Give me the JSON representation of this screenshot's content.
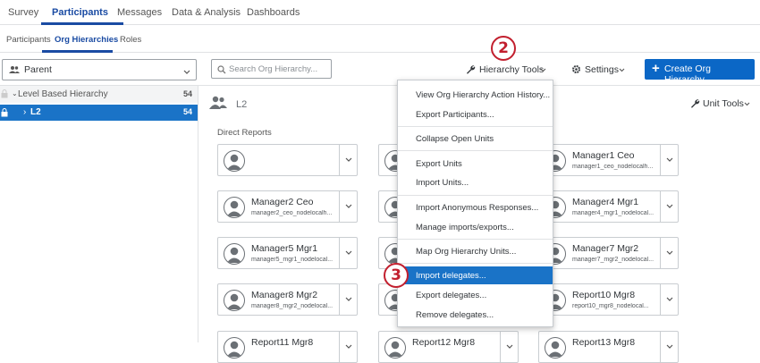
{
  "top_tabs": [
    "Survey",
    "Participants",
    "Messages",
    "Data & Analysis",
    "Dashboards"
  ],
  "sub_tabs": [
    "Participants",
    "Org Hierarchies",
    "Roles"
  ],
  "toolbar": {
    "parent_label": "Parent",
    "search_placeholder": "Search Org Hierarchy...",
    "hierarchy_tools": "Hierarchy Tools",
    "settings": "Settings",
    "create": "Create Org Hierarchy..."
  },
  "tree": [
    {
      "label": "Level Based Hierarchy",
      "count": "54"
    },
    {
      "label": "L2",
      "count": "54"
    }
  ],
  "main": {
    "unit_label": "L2",
    "unit_tools": "Unit Tools",
    "direct_reports": "Direct Reports"
  },
  "cards": [
    {
      "name": "",
      "email": ""
    },
    {
      "name": "",
      "email": ""
    },
    {
      "name": "Manager1 Ceo",
      "email": "manager1_ceo_nodelocalh..."
    },
    {
      "name": "Manager2 Ceo",
      "email": "manager2_ceo_nodelocalh..."
    },
    {
      "name": "",
      "email": ""
    },
    {
      "name": "Manager4 Mgr1",
      "email": "manager4_mgr1_nodelocal..."
    },
    {
      "name": "Manager5 Mgr1",
      "email": "manager5_mgr1_nodelocal..."
    },
    {
      "name": "",
      "email": ""
    },
    {
      "name": "Manager7 Mgr2",
      "email": "manager7_mgr2_nodelocal..."
    },
    {
      "name": "Manager8 Mgr2",
      "email": "manager8_mgr2_nodelocal..."
    },
    {
      "name": "",
      "email": ""
    },
    {
      "name": "Report10 Mgr8",
      "email": "report10_mgr8_nodelocal..."
    },
    {
      "name": "Report11 Mgr8",
      "email": ""
    },
    {
      "name": "Report12 Mgr8",
      "email": ""
    },
    {
      "name": "Report13 Mgr8",
      "email": ""
    }
  ],
  "menu": [
    "View Org Hierarchy Action History...",
    "Export Participants...",
    "Collapse Open Units",
    "Export Units",
    "Import Units...",
    "Import Anonymous Responses...",
    "Manage imports/exports...",
    "Map Org Hierarchy Units...",
    "Import delegates...",
    "Export delegates...",
    "Remove delegates..."
  ],
  "steps": [
    "2",
    "3"
  ],
  "colors": {
    "accent": "#1a4ba3",
    "highlight": "#1a73c7",
    "button": "#0b67c6",
    "step": "#c21f2e"
  }
}
